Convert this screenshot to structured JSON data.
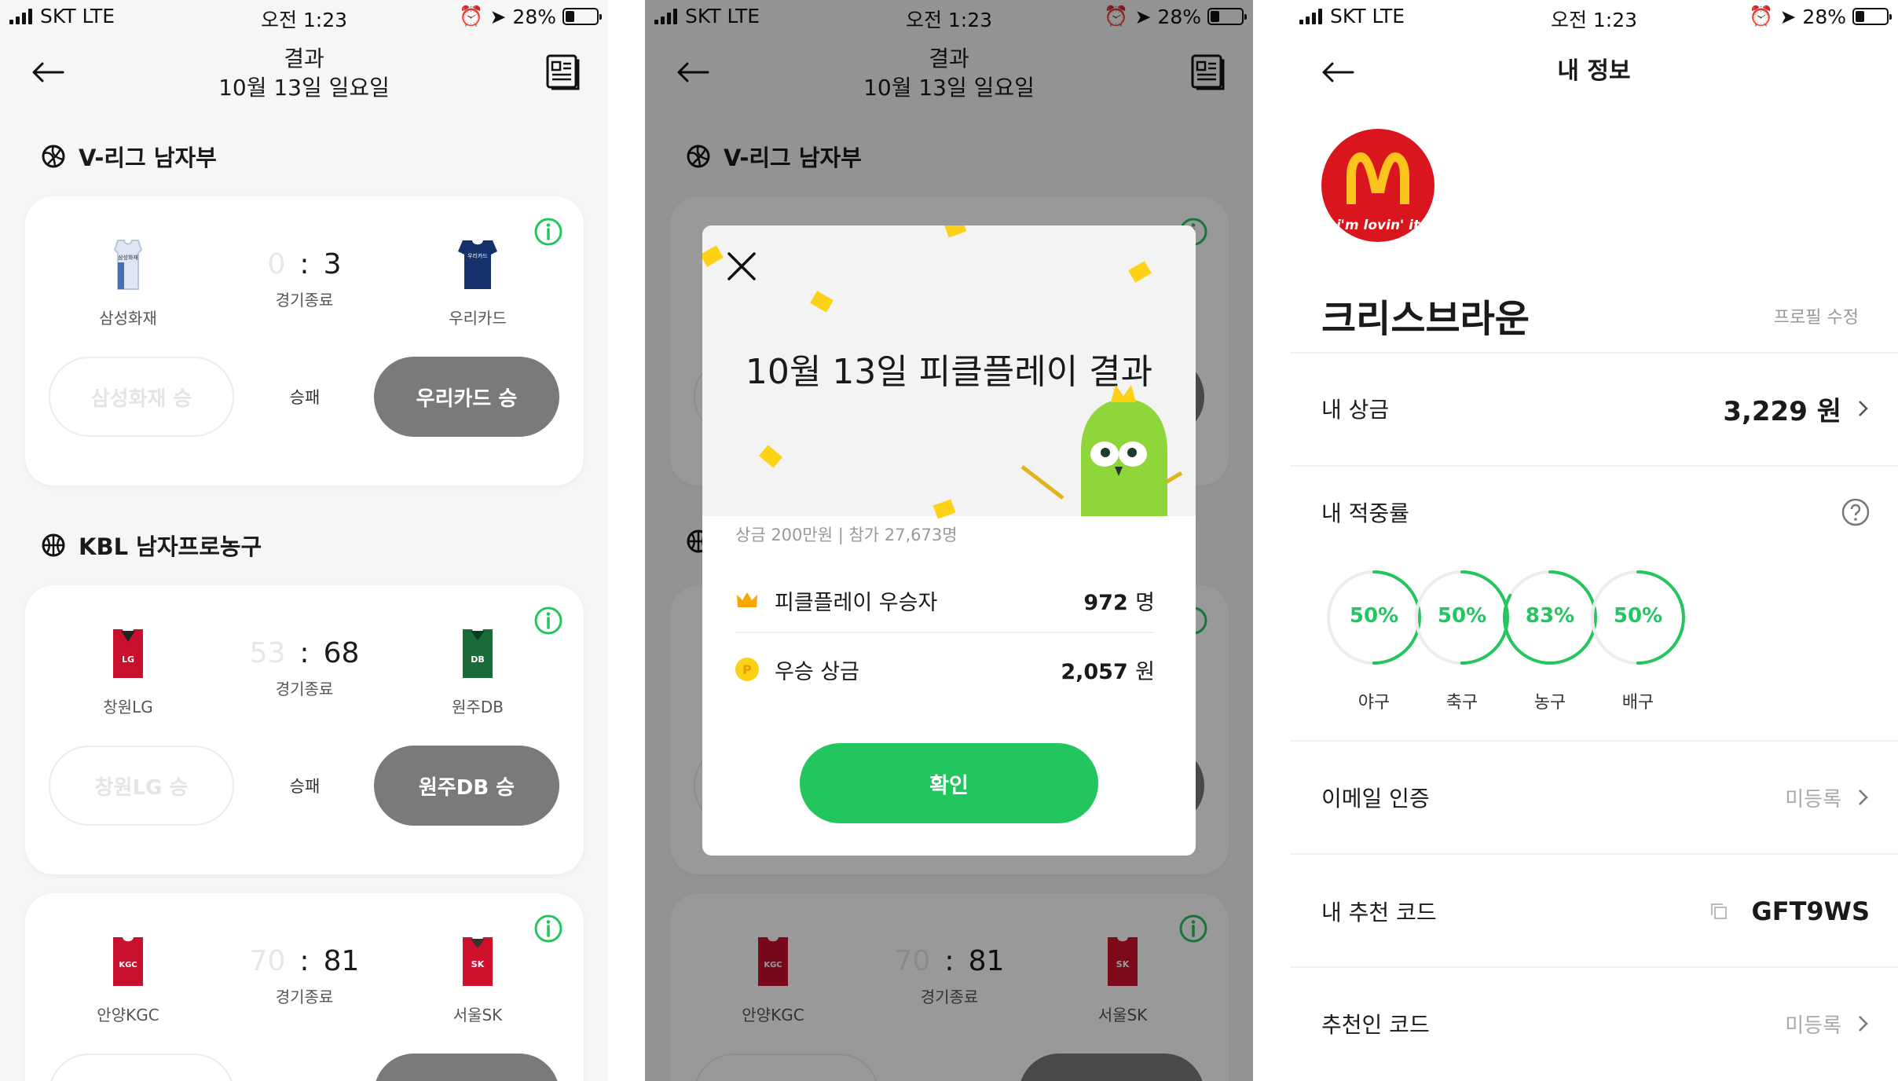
{
  "status_bar": {
    "carrier": "SKT LTE",
    "time": "오전 1:23",
    "battery": "28%",
    "battery_level": 0.28
  },
  "results_screen": {
    "title": "결과",
    "date": "10월 13일 일요일",
    "sections": [
      {
        "name": "V-리그 남자부",
        "icon": "volleyball-icon"
      },
      {
        "name": "KBL 남자프로농구",
        "icon": "basketball-icon"
      }
    ],
    "games": [
      {
        "home": "삼성화재",
        "away": "우리카드",
        "home_score": "0",
        "sep": ":",
        "away_score": "3",
        "status": "경기종료",
        "home_pick": "삼성화재 승",
        "middle": "승패",
        "away_pick": "우리카드 승",
        "home_color": "#dde6f2",
        "away_color": "#16306b",
        "home_mark": "삼성화재",
        "away_mark": "우리카드"
      },
      {
        "home": "창원LG",
        "away": "원주DB",
        "home_score": "53",
        "sep": ":",
        "away_score": "68",
        "status": "경기종료",
        "home_pick": "창원LG 승",
        "middle": "승패",
        "away_pick": "원주DB 승",
        "home_color": "#c8102e",
        "away_color": "#1b6b3a",
        "home_mark": "LG",
        "away_mark": "DB"
      },
      {
        "home": "안양KGC",
        "away": "서울SK",
        "home_score": "70",
        "sep": ":",
        "away_score": "81",
        "status": "경기종료",
        "home_color": "#c8102e",
        "away_color": "#c8102e",
        "home_mark": "KGC",
        "away_mark": "SK"
      }
    ]
  },
  "modal": {
    "title": "10월 13일 피클플레이 결과",
    "stats": "상금 200만원 | 참가 27,673명",
    "winners_label": "피클플레이 우승자",
    "winners_value": "972",
    "winners_unit": "명",
    "prize_label": "우승 상금",
    "prize_value": "2,057",
    "prize_unit": "원",
    "confirm": "확인",
    "coin": "P"
  },
  "profile": {
    "title": "내 정보",
    "avatar_text": "i'm lovin' it",
    "name": "크리스브라운",
    "edit": "프로필 수정",
    "prize_label": "내 상금",
    "prize_value": "3,229",
    "prize_unit": "원",
    "accuracy_label": "내 적중률",
    "accuracy": [
      {
        "sport": "야구",
        "pct": "50%",
        "value": 50
      },
      {
        "sport": "축구",
        "pct": "50%",
        "value": 50
      },
      {
        "sport": "농구",
        "pct": "83%",
        "value": 83
      },
      {
        "sport": "배구",
        "pct": "50%",
        "value": 50
      }
    ],
    "email_label": "이메일 인증",
    "email_value": "미등록",
    "referral_label": "내 추천 코드",
    "referral_value": "GFT9WS",
    "referrer_label": "추천인 코드",
    "referrer_value": "미등록"
  },
  "colors": {
    "accent": "#23c55e",
    "pick_filled": "#7a7a7a",
    "confetti": "#fcd116"
  }
}
